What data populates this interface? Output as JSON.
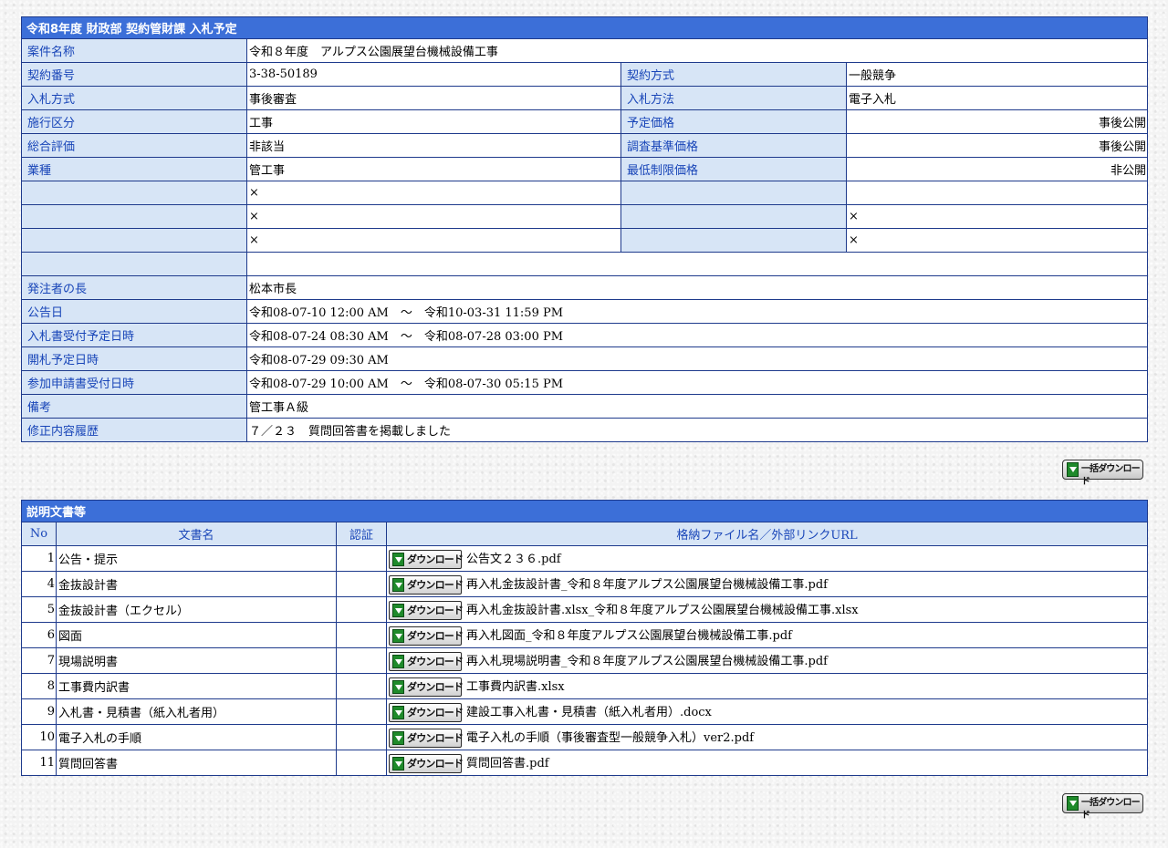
{
  "info": {
    "title": "令和8年度 財政部 契約管財課 入札予定",
    "project_name_label": "案件名称",
    "project_name": "令和８年度　アルプス公園展望台機械設備工事",
    "contract_no_label": "契約番号",
    "contract_no": "3-38-50189",
    "contract_method_label": "契約方式",
    "contract_method": "一般競争",
    "bid_type_label": "入札方式",
    "bid_type": "事後審査",
    "bid_method_label": "入札方法",
    "bid_method": "電子入札",
    "division_label": "施行区分",
    "division": "工事",
    "planned_price_label": "予定価格",
    "planned_price": "事後公開",
    "overall_eval_label": "総合評価",
    "overall_eval": "非該当",
    "survey_price_label": "調査基準価格",
    "survey_price": "事後公開",
    "industry_label": "業種",
    "industry": "管工事",
    "min_price_label": "最低制限価格",
    "min_price": "非公開",
    "x_mark": "×",
    "orderer_label": "発注者の長",
    "orderer": "松本市長",
    "announce_label": "公告日",
    "announce": "令和08-07-10 12:00 AM　～　令和10-03-31 11:59 PM",
    "bid_accept_label": "入札書受付予定日時",
    "bid_accept": "令和08-07-24 08:30 AM　～　令和08-07-28 03:00 PM",
    "opening_label": "開札予定日時",
    "opening": "令和08-07-29 09:30 AM",
    "apply_label": "参加申請書受付日時",
    "apply": "令和08-07-29 10:00 AM　～　令和08-07-30 05:15 PM",
    "remarks_label": "備考",
    "remarks": "管工事Ａ級",
    "history_label": "修正内容履歴",
    "history": "７／２３　質問回答書を掲載しました"
  },
  "bulk_download_label": "一括ダウンロード",
  "docs": {
    "title": "説明文書等",
    "col_no": "No",
    "col_name": "文書名",
    "col_cert": "認証",
    "col_file": "格納ファイル名／外部リンクURL",
    "download_label": "ダウンロード",
    "rows": [
      {
        "no": "1",
        "name": "公告・提示",
        "file": "公告文２３６.pdf"
      },
      {
        "no": "4",
        "name": "金抜設計書",
        "file": "再入札金抜設計書_令和８年度アルプス公園展望台機械設備工事.pdf"
      },
      {
        "no": "5",
        "name": "金抜設計書（エクセル）",
        "file": "再入札金抜設計書.xlsx_令和８年度アルプス公園展望台機械設備工事.xlsx"
      },
      {
        "no": "6",
        "name": "図面",
        "file": "再入札図面_令和８年度アルプス公園展望台機械設備工事.pdf"
      },
      {
        "no": "7",
        "name": "現場説明書",
        "file": "再入札現場説明書_令和８年度アルプス公園展望台機械設備工事.pdf"
      },
      {
        "no": "8",
        "name": "工事費内訳書",
        "file": "工事費内訳書.xlsx"
      },
      {
        "no": "9",
        "name": "入札書・見積書（紙入札者用）",
        "file": "建設工事入札書・見積書（紙入札者用）.docx"
      },
      {
        "no": "10",
        "name": "電子入札の手順",
        "file": "電子入札の手順（事後審査型一般競争入札）ver2.pdf"
      },
      {
        "no": "11",
        "name": "質問回答書",
        "file": "質問回答書.pdf"
      }
    ]
  }
}
